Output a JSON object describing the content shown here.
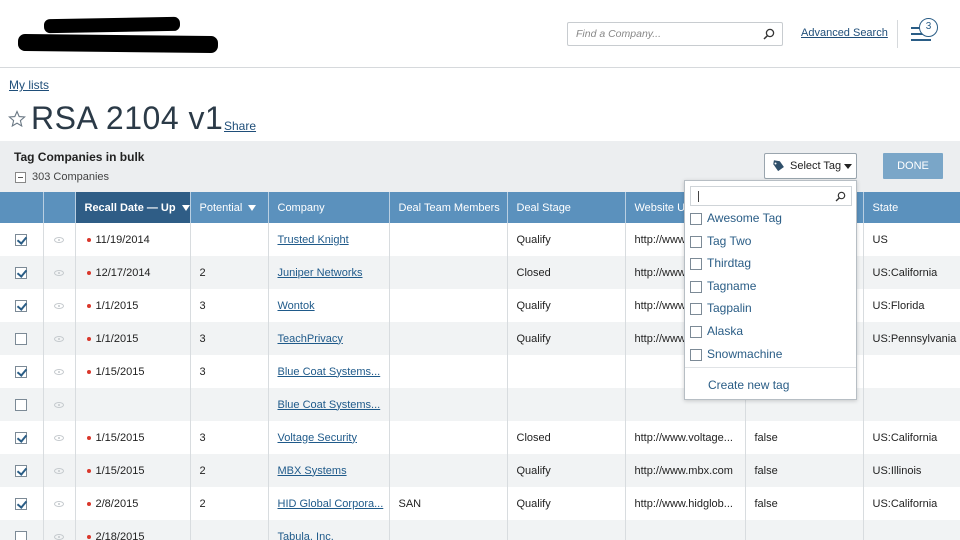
{
  "header": {
    "search_placeholder": "Find a Company...",
    "advanced_search": "Advanced Search",
    "notification_count": "3"
  },
  "nav": {
    "my_lists": "My lists"
  },
  "list": {
    "title": "RSA 2104 v1",
    "share": "Share"
  },
  "bulk": {
    "title": "Tag Companies in bulk",
    "count": "303 Companies",
    "select_tag": "Select Tag",
    "done": "DONE"
  },
  "table": {
    "columns": [
      "",
      "",
      "Recall Date — Up",
      "Potential",
      "Company",
      "Deal Team Members",
      "Deal Stage",
      "Website UR",
      "",
      "State"
    ],
    "rows": [
      {
        "checked": true,
        "dot": true,
        "date": "11/19/2014",
        "potential": "",
        "company": "Trusted Knight",
        "team": "",
        "stage": "Qualify",
        "website": "http://www",
        "flag": "",
        "state": "US"
      },
      {
        "checked": true,
        "dot": true,
        "date": "12/17/2014",
        "potential": "2",
        "company": "Juniper Networks",
        "team": "",
        "stage": "Closed",
        "website": "http://www",
        "flag": "",
        "state": "US:California"
      },
      {
        "checked": true,
        "dot": true,
        "date": "1/1/2015",
        "potential": "3",
        "company": "Wontok",
        "team": "",
        "stage": "Qualify",
        "website": "http://www",
        "flag": "",
        "state": "US:Florida"
      },
      {
        "checked": false,
        "dot": true,
        "date": "1/1/2015",
        "potential": "3",
        "company": "TeachPrivacy",
        "team": "",
        "stage": "Qualify",
        "website": "http://www",
        "flag": "",
        "state": "US:Pennsylvania"
      },
      {
        "checked": true,
        "dot": true,
        "date": "1/15/2015",
        "potential": "3",
        "company": "Blue Coat Systems...",
        "team": "",
        "stage": "",
        "website": "",
        "flag": "",
        "state": ""
      },
      {
        "checked": false,
        "dot": false,
        "date": "",
        "potential": "",
        "company": "Blue Coat Systems...",
        "team": "",
        "stage": "",
        "website": "",
        "flag": "",
        "state": ""
      },
      {
        "checked": true,
        "dot": true,
        "date": "1/15/2015",
        "potential": "3",
        "company": "Voltage Security",
        "team": "",
        "stage": "Closed",
        "website": "http://www.voltage...",
        "flag": "false",
        "state": "US:California"
      },
      {
        "checked": true,
        "dot": true,
        "date": "1/15/2015",
        "potential": "2",
        "company": "MBX Systems",
        "team": "",
        "stage": "Qualify",
        "website": "http://www.mbx.com",
        "flag": "false",
        "state": "US:Illinois"
      },
      {
        "checked": true,
        "dot": true,
        "date": "2/8/2015",
        "potential": "2",
        "company": "HID Global Corpora...",
        "team": "SAN",
        "stage": "Qualify",
        "website": "http://www.hidglob...",
        "flag": "false",
        "state": "US:California"
      },
      {
        "checked": false,
        "dot": true,
        "date": "2/18/2015",
        "potential": "",
        "company": "Tabula, Inc.",
        "team": "",
        "stage": "",
        "website": "",
        "flag": "",
        "state": ""
      }
    ]
  },
  "tag_dropdown": {
    "search_value": "",
    "options": [
      "Awesome Tag",
      "Tag Two",
      "Thirdtag",
      "Tagname",
      "Tagpalin",
      "Alaska",
      "Snowmachine"
    ],
    "create": "Create new tag"
  },
  "colors": {
    "header_blue": "#5b91bd",
    "sorted_header": "#2f5d86",
    "link": "#1f5a8a",
    "done_button": "#7aa6c8",
    "recall_dot": "#d9372b"
  }
}
